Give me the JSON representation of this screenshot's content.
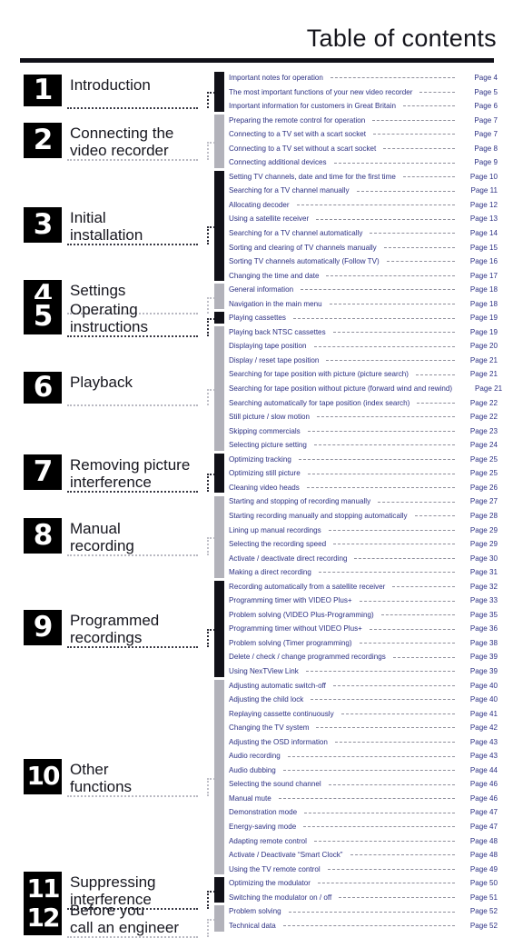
{
  "header": {
    "title": "Table of contents"
  },
  "sidebar": {
    "chapters": [
      {
        "number": "1",
        "label": "Introduction"
      },
      {
        "number": "2",
        "label": "Connecting the\nvideo recorder"
      },
      {
        "number": "3",
        "label": "Initial\ninstallation"
      },
      {
        "number": "4",
        "label": "Settings"
      },
      {
        "number": "5",
        "label": "Operating\ninstructions"
      },
      {
        "number": "6",
        "label": "Playback"
      },
      {
        "number": "7",
        "label": "Removing picture\ninterference"
      },
      {
        "number": "8",
        "label": "Manual\nrecording"
      },
      {
        "number": "9",
        "label": "Programmed\nrecordings"
      },
      {
        "number": "10",
        "label": "Other\nfunctions"
      },
      {
        "number": "11",
        "label": "Suppressing\ninterference"
      },
      {
        "number": "12",
        "label": "Before you\ncall an engineer"
      }
    ]
  },
  "contents": {
    "entries": [
      {
        "title": "Important notes for operation",
        "page": "Page 4"
      },
      {
        "title": "The most important functions of your new video recorder",
        "page": "Page 5"
      },
      {
        "title": "Important information for customers in Great Britain",
        "page": "Page 6"
      },
      {
        "title": "Preparing the remote control for operation",
        "page": "Page 7"
      },
      {
        "title": "Connecting to a TV set with a scart socket",
        "page": "Page 7"
      },
      {
        "title": "Connecting to a TV set without a scart socket",
        "page": "Page 8"
      },
      {
        "title": "Connecting additional devices",
        "page": "Page 9"
      },
      {
        "title": "Setting TV channels, date and time for the  first time",
        "page": "Page 10"
      },
      {
        "title": "Searching for a TV channel manually",
        "page": "Page 11"
      },
      {
        "title": "Allocating decoder",
        "page": "Page 12"
      },
      {
        "title": "Using a satellite receiver",
        "page": "Page 13"
      },
      {
        "title": "Searching for a TV channel automatically",
        "page": "Page 14"
      },
      {
        "title": "Sorting and clearing of TV channels manually",
        "page": "Page 15"
      },
      {
        "title": "Sorting TV channels automatically (Follow TV)",
        "page": "Page 16"
      },
      {
        "title": "Changing the time and date",
        "page": "Page 17"
      },
      {
        "title": "General information",
        "page": "Page 18"
      },
      {
        "title": "Navigation in the main menu",
        "page": "Page 18"
      },
      {
        "title": "Playing cassettes",
        "page": "Page 19"
      },
      {
        "title": "Playing back NTSC cassettes",
        "page": "Page 19"
      },
      {
        "title": "Displaying tape position",
        "page": "Page 20"
      },
      {
        "title": "Display / reset tape position",
        "page": "Page 21"
      },
      {
        "title": "Searching for tape position with picture (picture search)",
        "page": "Page 21"
      },
      {
        "title": "Searching for tape position without picture (forward wind and rewind)",
        "page": "Page 21"
      },
      {
        "title": "Searching automatically for tape position (index search)",
        "page": "Page 22"
      },
      {
        "title": "Still picture /  slow motion",
        "page": "Page 22"
      },
      {
        "title": "Skipping commercials",
        "page": "Page 23"
      },
      {
        "title": "Selecting picture setting",
        "page": "Page 24"
      },
      {
        "title": "Optimizing tracking",
        "page": "Page 25"
      },
      {
        "title": "Optimizing still picture",
        "page": "Page 25"
      },
      {
        "title": "Cleaning video heads",
        "page": "Page 26"
      },
      {
        "title": "Starting and stopping of recording manually",
        "page": "Page 27"
      },
      {
        "title": "Starting recording manually and stopping automatically",
        "page": "Page 28"
      },
      {
        "title": "Lining up manual recordings",
        "page": "Page 29"
      },
      {
        "title": "Selecting the recording speed",
        "page": "Page 29"
      },
      {
        "title": "Activate / deactivate direct recording",
        "page": "Page 30"
      },
      {
        "title": "Making a direct recording",
        "page": "Page 31"
      },
      {
        "title": "Recording automatically from a satellite receiver",
        "page": "Page 32"
      },
      {
        "title": "Programming timer with VIDEO Plus+",
        "page": "Page 33"
      },
      {
        "title": "Problem solving (VIDEO Plus-Programming)",
        "page": "Page 35"
      },
      {
        "title": "Programming timer without VIDEO Plus+",
        "page": "Page 36"
      },
      {
        "title": "Problem solving (Timer programming)",
        "page": "Page 38"
      },
      {
        "title": "Delete / check / change programmed recordings",
        "page": "Page 39"
      },
      {
        "title": "Using NexTView Link",
        "page": "Page 39"
      },
      {
        "title": "Adjusting automatic switch-off",
        "page": "Page 40"
      },
      {
        "title": "Adjusting the child lock",
        "page": "Page 40"
      },
      {
        "title": "Replaying cassette continuously",
        "page": "Page 41"
      },
      {
        "title": "Changing the TV system",
        "page": "Page 42"
      },
      {
        "title": "Adjusting the OSD information",
        "page": "Page 43"
      },
      {
        "title": "Audio recording",
        "page": "Page 43"
      },
      {
        "title": "Audio dubbing",
        "page": "Page 44"
      },
      {
        "title": "Selecting the sound channel",
        "page": "Page 46"
      },
      {
        "title": "Manual mute",
        "page": "Page 46"
      },
      {
        "title": "Demonstration mode",
        "page": "Page 47"
      },
      {
        "title": "Energy-saving mode",
        "page": "Page 47"
      },
      {
        "title": "Adapting remote control",
        "page": "Page 48"
      },
      {
        "title": "Activate / Deactivate “Smart Clock”",
        "page": "Page 48"
      },
      {
        "title": "Using the TV remote control",
        "page": "Page 49"
      },
      {
        "title": "Optimizing the modulator",
        "page": "Page 50"
      },
      {
        "title": "Switching the modulator on / off",
        "page": "Page 51"
      },
      {
        "title": "Problem solving",
        "page": "Page 52"
      },
      {
        "title": "Technical data",
        "page": "Page 52"
      }
    ]
  },
  "groups": [
    {
      "chapter": "1",
      "start_index": 0,
      "count": 3,
      "tone": "dark"
    },
    {
      "chapter": "2",
      "start_index": 3,
      "count": 4,
      "tone": "light"
    },
    {
      "chapter": "3",
      "start_index": 7,
      "count": 8,
      "tone": "dark"
    },
    {
      "chapter": "4",
      "start_index": 15,
      "count": 2,
      "tone": "light"
    },
    {
      "chapter": "5",
      "start_index": 17,
      "count": 1,
      "tone": "dark"
    },
    {
      "chapter": "6",
      "start_index": 18,
      "count": 9,
      "tone": "light"
    },
    {
      "chapter": "7",
      "start_index": 27,
      "count": 3,
      "tone": "dark"
    },
    {
      "chapter": "8",
      "start_index": 30,
      "count": 6,
      "tone": "light"
    },
    {
      "chapter": "9",
      "start_index": 36,
      "count": 7,
      "tone": "dark"
    },
    {
      "chapter": "10",
      "start_index": 43,
      "count": 14,
      "tone": "light"
    },
    {
      "chapter": "11",
      "start_index": 57,
      "count": 2,
      "tone": "dark"
    },
    {
      "chapter": "12",
      "start_index": 59,
      "count": 2,
      "tone": "light"
    }
  ],
  "theme": {
    "accent_dark": "#111118",
    "accent_light": "#b2b2ba",
    "toc_text": "#2b2f82",
    "title_text": "#15151c"
  }
}
